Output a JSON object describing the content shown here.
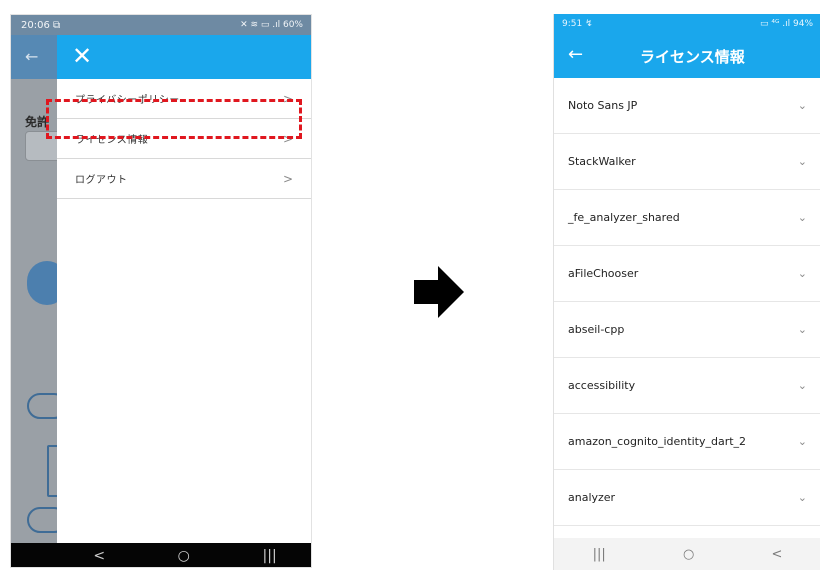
{
  "left_phone": {
    "status": {
      "time": "20:06 ⧉",
      "indicators": "✕ ≋ ▭ .ıl 60%"
    },
    "background": {
      "back_arrow": "←",
      "label": "免許"
    },
    "drawer": {
      "close": "✕",
      "items": [
        {
          "label": "プライバシーポリシー",
          "chevron": ">"
        },
        {
          "label": "ライセンス情報",
          "chevron": ">",
          "highlighted": true
        },
        {
          "label": "ログアウト",
          "chevron": ">"
        }
      ]
    },
    "navbar": {
      "back": "<",
      "home": "○",
      "recents": "|||"
    }
  },
  "arrow_icon": "right-arrow",
  "right_phone": {
    "status": {
      "time": "9:51 ↯",
      "indicators": "▭ ⁴ᴳ .ıl 94%"
    },
    "header": {
      "back": "←",
      "title": "ライセンス情報"
    },
    "licenses": [
      "Noto Sans JP",
      "StackWalker",
      "_fe_analyzer_shared",
      "aFileChooser",
      "abseil-cpp",
      "accessibility",
      "amazon_cognito_identity_dart_2",
      "analyzer"
    ],
    "row_chevron": "⌄",
    "navbar": {
      "recents": "|||",
      "home": "○",
      "back": "<"
    }
  },
  "colors": {
    "accent": "#1aa7ec",
    "highlight": "#e0171f"
  }
}
